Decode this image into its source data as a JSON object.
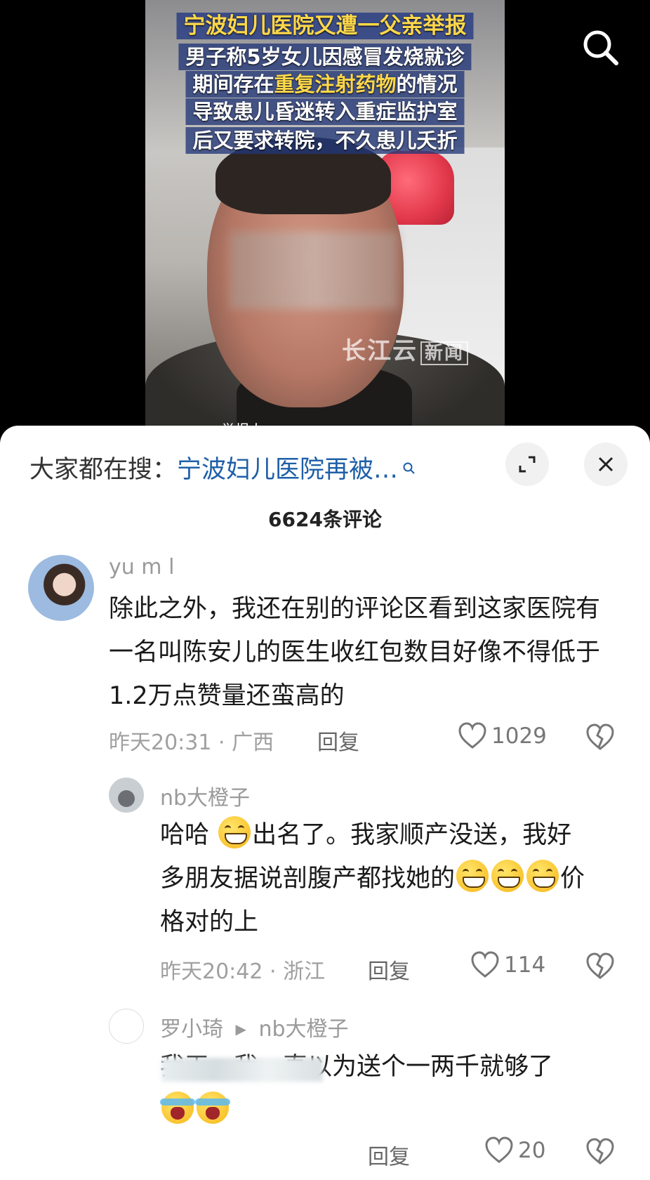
{
  "video": {
    "captions": {
      "title": "宁波妇儿医院又遭一父亲举报",
      "line1": "男子称5岁女儿因感冒发烧就诊",
      "line2_pre": "期间存在",
      "line2_hl": "重复注射药物",
      "line2_post": "的情况",
      "line3": "导致患儿昏迷转入重症监护室",
      "line4": "后又要求转院，不久患儿夭折"
    },
    "watermark": "长江云",
    "watermark_tag": "新闻",
    "reporter_label": "举报人："
  },
  "sheet": {
    "suggest_label": "大家都在搜：",
    "suggest_query": "宁波妇儿医院再被…",
    "comment_count": "6624条评论"
  },
  "comments": [
    {
      "user": "yu  m  l",
      "text": "除此之外，我还在别的评论区看到这家医院有一名叫陈安儿的医生收红包数目好像不得低于1.2万点赞量还蛮高的",
      "time": "昨天20:31 · 广西",
      "reply": "回复",
      "likes": "1029"
    },
    {
      "user": "nb大橙子",
      "text_a": "哈哈",
      "text_b": "出名了。我家顺产没送，我好",
      "text_c": "多朋友据说剖腹产都找她的",
      "text_d": "价",
      "text_e": "格对的上",
      "time": "昨天20:42 · 浙江",
      "reply": "回复",
      "likes": "114"
    },
    {
      "user": "罗小琦",
      "reply_to": "nb大橙子",
      "text": "我天，我一直以为送个一两千就够了",
      "reply": "回复",
      "likes": "20"
    }
  ],
  "colors": {
    "link": "#1f5fa8",
    "caption_yellow": "#ffd84a"
  }
}
